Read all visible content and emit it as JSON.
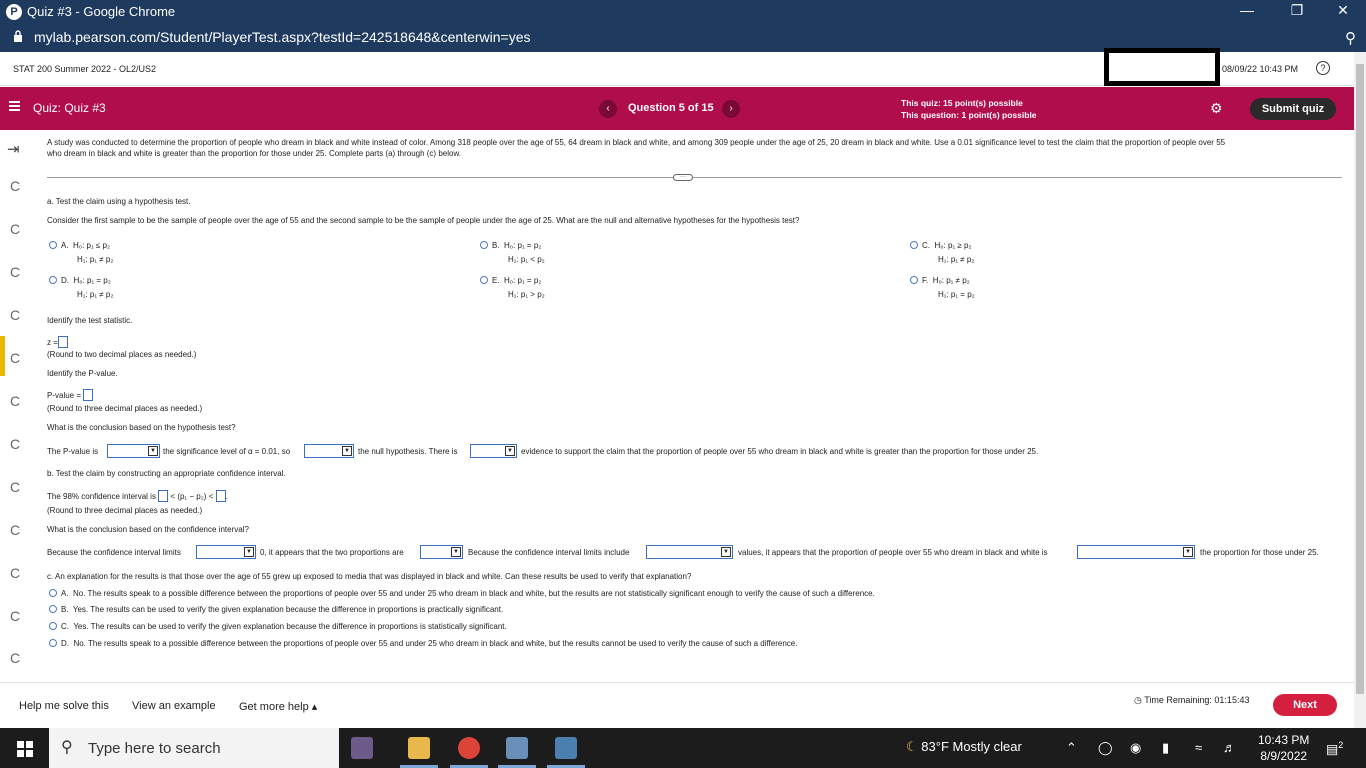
{
  "browser": {
    "window_title": "Quiz #3 - Google Chrome",
    "url": "mylab.pearson.com/Student/PlayerTest.aspx?testId=242518648&centerwin=yes"
  },
  "course": {
    "name": "STAT 200 Summer 2022 - OL2/US2",
    "datetime": "08/09/22 10:43 PM",
    "help": "?"
  },
  "quiz_header": {
    "title": "Quiz:  Quiz #3",
    "question_nav": "Question 5 of 15",
    "prev": "‹",
    "next": "›",
    "quiz_points": "This quiz: 15 point(s) possible",
    "question_points": "This question: 1 point(s) possible",
    "submit_label": "Submit quiz"
  },
  "problem": {
    "intro_line1": "A study was conducted to determine the proportion of people who dream in black and white instead of color. Among 318 people over the age of 55, 64 dream in black and white, and among 309 people under the age of 25, 20 dream in black and white. Use a 0.01 significance level to test the claim that the proportion of people over 55",
    "intro_line2": "who dream in black and white is greater than the proportion for those under 25. Complete parts (a) through (c) below.",
    "part_a": "a. Test the claim using a hypothesis test.",
    "consider": "Consider the first sample to be the sample of people over the age of 55 and the second sample to be the sample of people under the age of 25. What are the null and alternative hypotheses for the hypothesis test?",
    "options": [
      {
        "letter": "A.",
        "h0": "H₀: p₁ ≤ p₂",
        "h1": "H₁: p₁ ≠ p₂"
      },
      {
        "letter": "B.",
        "h0": "H₀: p₁ = p₂",
        "h1": "H₁: p₁ < p₂"
      },
      {
        "letter": "C.",
        "h0": "H₀: p₁ ≥ p₂",
        "h1": "H₁: p₁ ≠ p₂"
      },
      {
        "letter": "D.",
        "h0": "H₀: p₁ = p₂",
        "h1": "H₁: p₁ ≠ p₂"
      },
      {
        "letter": "E.",
        "h0": "H₀: p₁ = p₂",
        "h1": "H₁: p₁ > p₂"
      },
      {
        "letter": "F.",
        "h0": "H₀: p₁ ≠ p₂",
        "h1": "H₁: p₁ = p₂"
      }
    ],
    "identify_stat": "Identify the test statistic.",
    "z_label": "z =",
    "round2": "(Round to two decimal places as needed.)",
    "identify_p": "Identify the P-value.",
    "p_label": "P-value =",
    "round3": "(Round to three decimal places as needed.)",
    "conclusion_q": "What is the conclusion based on the hypothesis test?",
    "pv_sentence_1": "The P-value is",
    "pv_sentence_2": "the significance level of α = 0.01, so",
    "pv_sentence_3": "the null hypothesis. There is",
    "pv_sentence_4": "evidence to support the claim that the proportion of people over 55 who dream in black and white is greater than the proportion for those under 25.",
    "part_b": "b. Test the claim by constructing an appropriate confidence interval.",
    "ci_1": "The 98% confidence interval is",
    "ci_2": "< (p₁ − p₂) <",
    "ci_3": ".",
    "round3b": "(Round to three decimal places as needed.)",
    "ci_conclusion_q": "What is the conclusion based on the confidence interval?",
    "ci_s1": "Because the confidence interval limits",
    "ci_s2": "0, it appears that the two proportions are",
    "ci_s3": "Because the confidence interval limits include",
    "ci_s4": "values, it appears that the proportion of people over 55 who dream in black and white is",
    "ci_s5": "the proportion for those under 25.",
    "part_c": "c. An explanation for the results is that those over the age of 55 grew up exposed to media that was displayed in black and white. Can these results be used to verify that explanation?",
    "c_options": [
      {
        "letter": "A.",
        "text": "No. The results speak to a possible difference between the proportions of people over 55 and under 25 who dream in black and white, but the results are not statistically significant enough to verify the cause of such a difference."
      },
      {
        "letter": "B.",
        "text": "Yes. The results can be used to verify the given explanation because the difference in proportions is practically significant."
      },
      {
        "letter": "C.",
        "text": "Yes. The results can be used to verify the given explanation because the difference in proportions is statistically significant."
      },
      {
        "letter": "D.",
        "text": "No. The results speak to a possible difference between the proportions of people over 55 and under 25 who dream in black and white, but the results cannot be used to verify the cause of such a difference."
      }
    ]
  },
  "bottom": {
    "help_solve": "Help me solve this",
    "view_example": "View an example",
    "more_help": "Get more help ▴",
    "time_remaining": "Time Remaining:",
    "time_value": "01:15:43",
    "next_label": "Next"
  },
  "taskbar": {
    "search_placeholder": "Type here to search",
    "weather": "83°F  Mostly clear",
    "time": "10:43 PM",
    "date": "8/9/2022",
    "notifications": "2"
  }
}
